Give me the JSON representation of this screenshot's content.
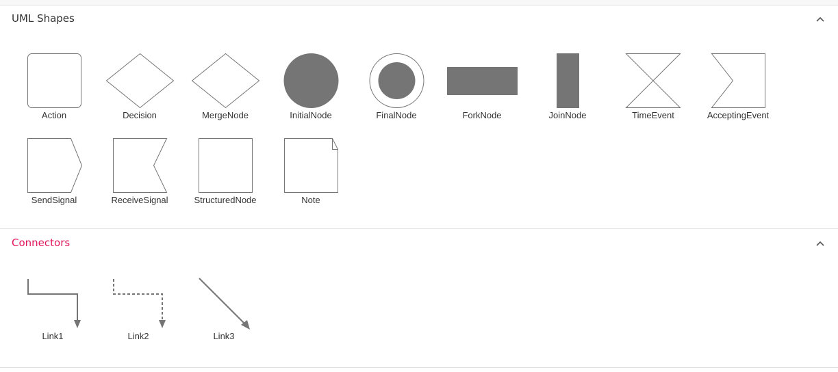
{
  "colors": {
    "shape_stroke": "#757575",
    "shape_fill": "#757575",
    "active_header": "#e3165b",
    "header_text": "#333333"
  },
  "sections": [
    {
      "title": "UML Shapes",
      "expanded": true,
      "chevron_icon": "chevron-up-icon",
      "items": [
        {
          "label": "Action",
          "icon": "action-shape"
        },
        {
          "label": "Decision",
          "icon": "decision-shape"
        },
        {
          "label": "MergeNode",
          "icon": "merge-node-shape"
        },
        {
          "label": "InitialNode",
          "icon": "initial-node-shape"
        },
        {
          "label": "FinalNode",
          "icon": "final-node-shape"
        },
        {
          "label": "ForkNode",
          "icon": "fork-node-shape"
        },
        {
          "label": "JoinNode",
          "icon": "join-node-shape"
        },
        {
          "label": "TimeEvent",
          "icon": "time-event-shape"
        },
        {
          "label": "AcceptingEvent",
          "icon": "accepting-event-shape"
        },
        {
          "label": "SendSignal",
          "icon": "send-signal-shape"
        },
        {
          "label": "ReceiveSignal",
          "icon": "receive-signal-shape"
        },
        {
          "label": "StructuredNode",
          "icon": "structured-node-shape"
        },
        {
          "label": "Note",
          "icon": "note-shape"
        }
      ]
    },
    {
      "title": "Connectors",
      "expanded": true,
      "chevron_icon": "chevron-up-icon",
      "items": [
        {
          "label": "Link1",
          "icon": "orthogonal-solid-connector"
        },
        {
          "label": "Link2",
          "icon": "orthogonal-dashed-connector"
        },
        {
          "label": "Link3",
          "icon": "straight-connector"
        }
      ]
    }
  ]
}
